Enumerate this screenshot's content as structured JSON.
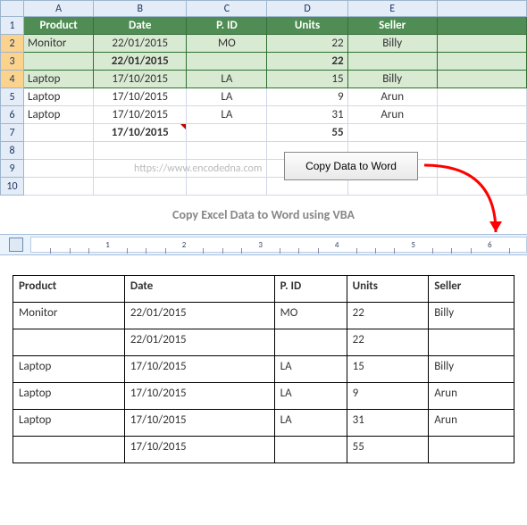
{
  "columns": [
    "A",
    "B",
    "C",
    "D",
    "E"
  ],
  "row_numbers": [
    1,
    2,
    3,
    4,
    5,
    6,
    7,
    8,
    9,
    10
  ],
  "header": {
    "A": "Product",
    "B": "Date",
    "C": "P. ID",
    "D": "Units",
    "E": "Seller"
  },
  "rows": [
    {
      "A": "Monitor",
      "B": "22/01/2015",
      "C": "MO",
      "D": "22",
      "E": "Billy",
      "sel": true
    },
    {
      "A": "",
      "B": "22/01/2015",
      "C": "",
      "D": "22",
      "E": "",
      "sel": true,
      "bold": true
    },
    {
      "A": "Laptop",
      "B": "17/10/2015",
      "C": "LA",
      "D": "15",
      "E": "Billy",
      "sel": true
    },
    {
      "A": "Laptop",
      "B": "17/10/2015",
      "C": "LA",
      "D": "9",
      "E": "Arun"
    },
    {
      "A": "Laptop",
      "B": "17/10/2015",
      "C": "LA",
      "D": "31",
      "E": "Arun"
    },
    {
      "A": "",
      "B": "17/10/2015",
      "C": "",
      "D": "55",
      "E": "",
      "bold": true,
      "ind": true
    }
  ],
  "watermark": "https://www.encodedna.com",
  "button_label": "Copy Data to Word",
  "caption": "Copy Excel Data to Word using VBA",
  "ruler_numbers": [
    1,
    2,
    3,
    4,
    5,
    6
  ],
  "word_header": [
    "Product",
    "Date",
    "P. ID",
    "Units",
    "Seller"
  ],
  "word_rows": [
    [
      "Monitor",
      "22/01/2015",
      "MO",
      "22",
      "Billy"
    ],
    [
      "",
      "22/01/2015",
      "",
      "22",
      ""
    ],
    [
      "Laptop",
      "17/10/2015",
      "LA",
      "15",
      "Billy"
    ],
    [
      "Laptop",
      "17/10/2015",
      "LA",
      "9",
      "Arun"
    ],
    [
      "Laptop",
      "17/10/2015",
      "LA",
      "31",
      "Arun"
    ],
    [
      "",
      "17/10/2015",
      "",
      "55",
      ""
    ]
  ],
  "chart_data": {
    "type": "table",
    "title": "Copy Excel Data to Word using VBA",
    "columns": [
      "Product",
      "Date",
      "P. ID",
      "Units",
      "Seller"
    ],
    "rows": [
      [
        "Monitor",
        "22/01/2015",
        "MO",
        22,
        "Billy"
      ],
      [
        "",
        "22/01/2015",
        "",
        22,
        ""
      ],
      [
        "Laptop",
        "17/10/2015",
        "LA",
        15,
        "Billy"
      ],
      [
        "Laptop",
        "17/10/2015",
        "LA",
        9,
        "Arun"
      ],
      [
        "Laptop",
        "17/10/2015",
        "LA",
        31,
        "Arun"
      ],
      [
        "",
        "17/10/2015",
        "",
        55,
        ""
      ]
    ]
  }
}
